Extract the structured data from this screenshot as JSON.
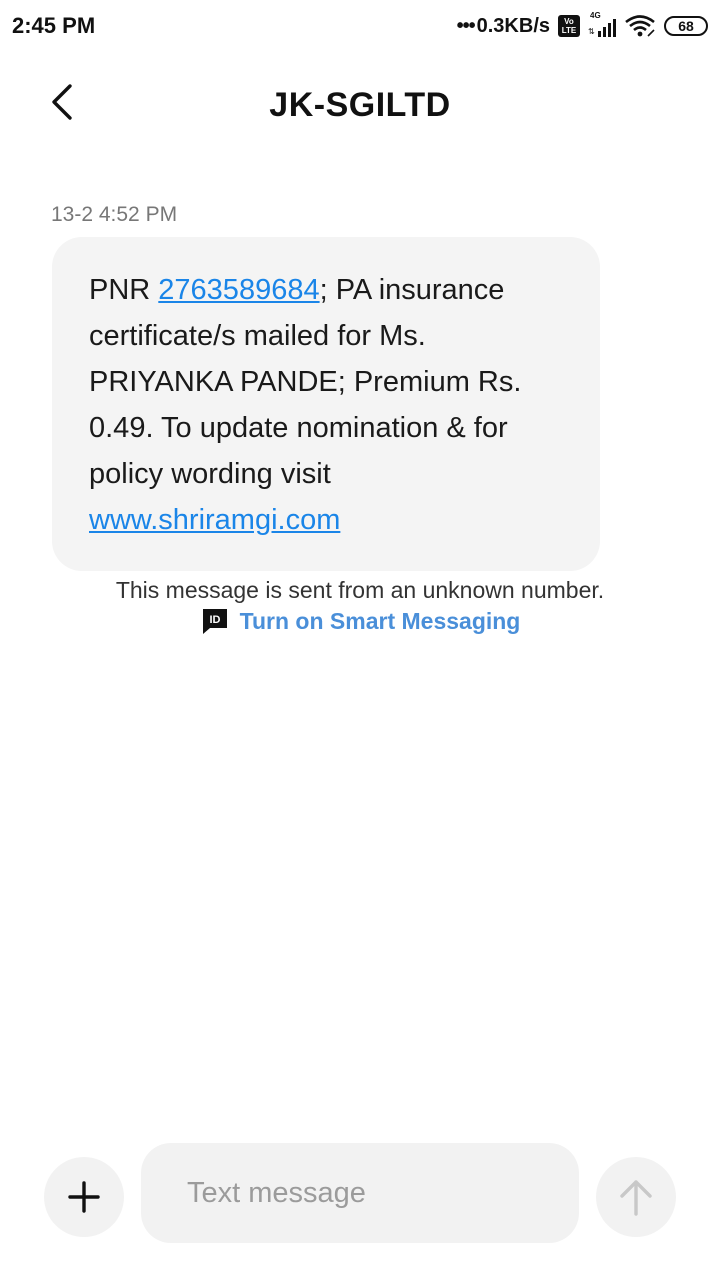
{
  "status_bar": {
    "time": "2:45 PM",
    "network_speed": "0.3KB/s",
    "volte_line1": "Vo",
    "volte_line2": "LTE",
    "network_type": "4G",
    "battery": "68"
  },
  "header": {
    "title": "JK-SGILTD",
    "back_icon": "chevron-left-icon"
  },
  "conversation": {
    "timestamp": "13-2 4:52 PM",
    "message": {
      "prefix": "PNR ",
      "pnr_link": "2763589684",
      "body": "; PA insurance certificate/s mailed for Ms. PRIYANKA PANDE; Premium Rs. 0.49. To update nomination & for policy wording visit ",
      "url_link": "www.shriramgi.com"
    },
    "unknown_notice": "This message is sent from an unknown number.",
    "smart_messaging_label": "Turn on Smart Messaging",
    "smart_messaging_icon": "id-icon"
  },
  "composer": {
    "placeholder": "Text message",
    "add_icon": "plus-icon",
    "send_icon": "arrow-up-icon"
  },
  "colors": {
    "link": "#1a85e8",
    "smart_link": "#4a8fd9",
    "bubble": "#f4f4f4"
  }
}
